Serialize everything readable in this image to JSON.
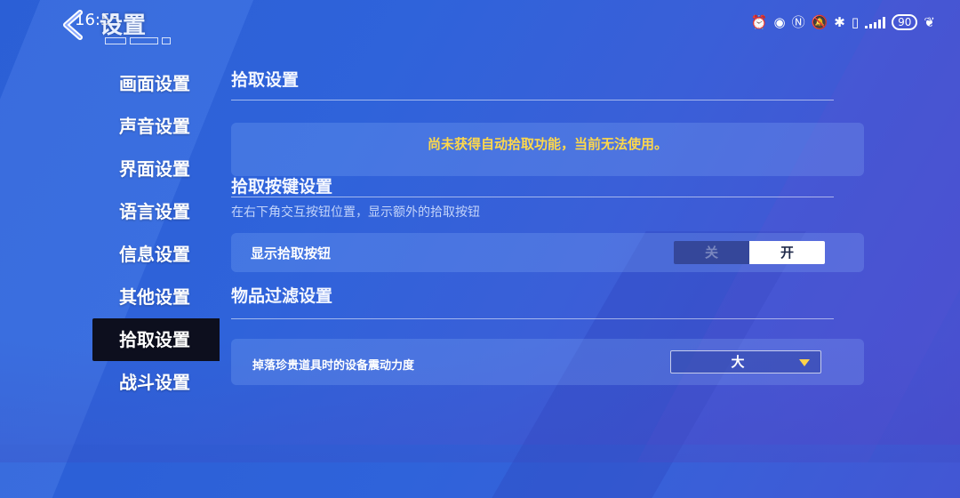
{
  "status": {
    "time": "16:55",
    "battery": "90"
  },
  "header": {
    "title": "设置"
  },
  "sidebar": {
    "items": [
      {
        "label": "画面设置"
      },
      {
        "label": "声音设置"
      },
      {
        "label": "界面设置"
      },
      {
        "label": "语言设置"
      },
      {
        "label": "信息设置"
      },
      {
        "label": "其他设置"
      },
      {
        "label": "拾取设置"
      },
      {
        "label": "战斗设置"
      }
    ],
    "active_index": 6
  },
  "main": {
    "title": "拾取设置",
    "warning": "尚未获得自动拾取功能，当前无法使用。",
    "pickup_button_section": {
      "title": "拾取按键设置",
      "hint": "在右下角交互按钮位置，显示额外的拾取按钮",
      "row_label": "显示拾取按钮",
      "toggle_off": "关",
      "toggle_on": "开",
      "selected": "开"
    },
    "filter_section": {
      "title": "物品过滤设置",
      "row_label": "掉落珍贵道具时的设备震动力度",
      "dropdown_value": "大"
    }
  },
  "colors": {
    "warning": "#ffd84a",
    "active_tab_bg": "#0d0f1e",
    "caret": "#ffd24a"
  },
  "icons": {
    "back": "chevron-left-icon",
    "dropdown": "caret-down-icon"
  }
}
